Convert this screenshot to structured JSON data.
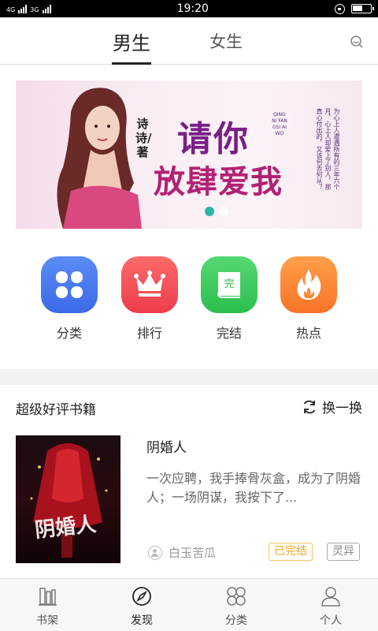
{
  "status_bar": {
    "network_left": "4G",
    "network_right": "3G",
    "time": "19:20"
  },
  "top_tabs": {
    "male": "男生",
    "female": "女生",
    "active": "男生"
  },
  "banner": {
    "author_label": "诗诗/著",
    "title_line1": "请你",
    "title_line2": "放肆爱我",
    "pinyin": "QINGNI FANGSI AIWO",
    "tagline": "为心上人遭遇所有的三年六个月，心上人却爱上了别人，那真心付出的，又该何去何从？",
    "active_slide": 1,
    "slide_count": 2,
    "accent_color": "#2bb5a6"
  },
  "categories": [
    {
      "label": "分类",
      "icon": "category-grid-icon",
      "color": "#4a7cf0"
    },
    {
      "label": "排行",
      "icon": "crown-icon",
      "color": "#f4505a"
    },
    {
      "label": "完结",
      "icon": "finished-book-icon",
      "color": "#3ccb5f"
    },
    {
      "label": "热点",
      "icon": "flame-icon",
      "color": "#fb8a36"
    }
  ],
  "section": {
    "title": "超级好评书籍",
    "refresh_label": "换一换"
  },
  "book": {
    "title": "阴婚人",
    "description": "一次应聘，我手捧骨灰盒，成为了阴婚人；一场阴谋，我按下了...",
    "author": "白玉苦瓜",
    "status": "已完结",
    "genre": "灵异",
    "cover_text": "阴婚人"
  },
  "bottom_nav": [
    {
      "label": "书架",
      "icon": "bookshelf-icon",
      "active": false
    },
    {
      "label": "发现",
      "icon": "compass-icon",
      "active": true
    },
    {
      "label": "分类",
      "icon": "category-grid-icon",
      "active": false
    },
    {
      "label": "个人",
      "icon": "person-icon",
      "active": false
    }
  ]
}
